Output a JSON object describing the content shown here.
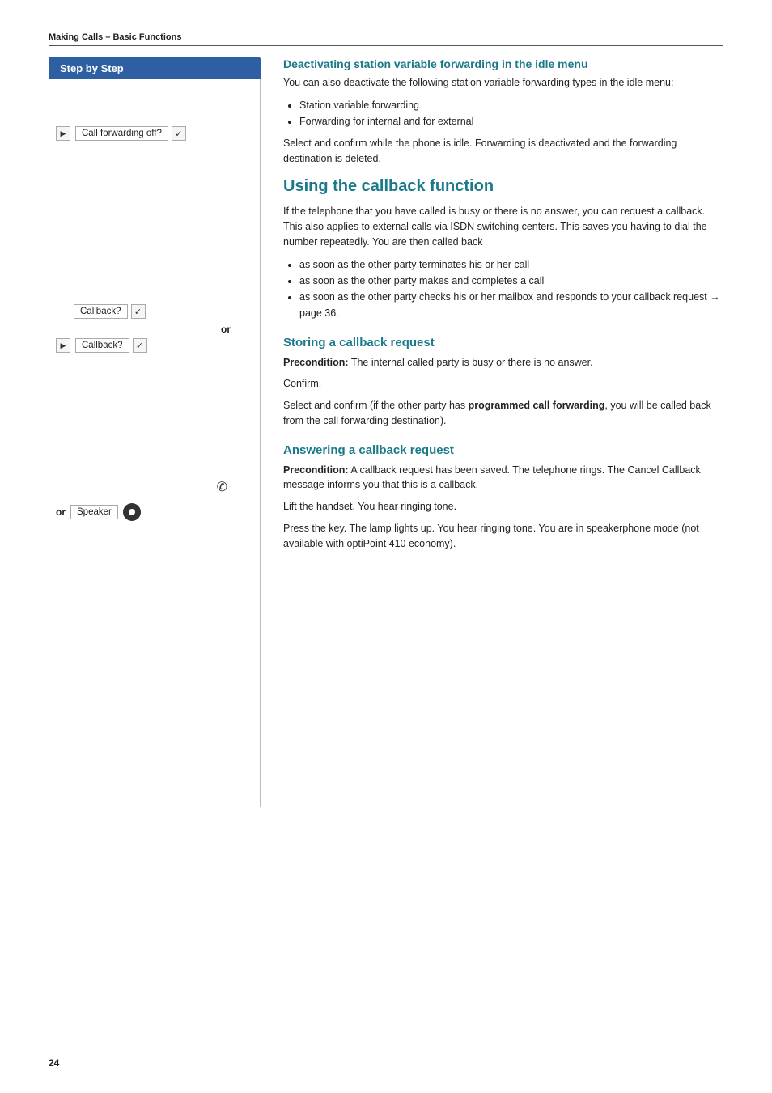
{
  "header": {
    "title": "Making Calls – Basic Functions"
  },
  "left_col": {
    "title": "Step by Step",
    "rows": [
      {
        "id": "call-forwarding-off",
        "has_play": true,
        "label": "Call forwarding off?",
        "has_check": true
      }
    ],
    "or_label": "or",
    "callback_rows": [
      {
        "id": "callback-1",
        "has_play": false,
        "label": "Callback?",
        "has_check": true
      },
      {
        "id": "callback-2",
        "has_play": true,
        "label": "Callback?",
        "has_check": true
      }
    ],
    "speaker_row": {
      "or_label": "or",
      "label": "Speaker"
    }
  },
  "right_col": {
    "deactivating_heading": "Deactivating station variable forwarding in the idle menu",
    "deactivating_intro": "You can also deactivate the following station variable forwarding types in the idle menu:",
    "deactivating_bullets": [
      "Station variable forwarding",
      "Forwarding for internal and for external"
    ],
    "deactivating_select_text": "Select and confirm while the phone is idle. Forwarding is deactivated and the forwarding destination is deleted.",
    "callback_section_title": "Using the callback function",
    "callback_intro": "If the telephone that you have called is busy or there is no answer, you can request a callback. This also applies to external calls via ISDN switching centers. This saves you having to dial the number repeatedly. You are then called back",
    "callback_bullets": [
      "as soon as the other party terminates his or her call",
      "as soon as the other party makes and completes a call",
      "as soon as the other party checks his or her mailbox and responds to your callback request → page 36."
    ],
    "storing_title": "Storing a callback request",
    "storing_precondition_label": "Precondition:",
    "storing_precondition_text": "The internal called party is busy or there is no answer.",
    "storing_confirm": "Confirm.",
    "storing_select": "Select and confirm (if the other party has ",
    "storing_select_bold": "programmed call forwarding",
    "storing_select_end": ", you will be called back from the call forwarding destination).",
    "answering_title": "Answering a callback request",
    "answering_precondition_label": "Precondition:",
    "answering_precondition_text": "A callback request has been saved. The telephone rings. The Cancel Callback message informs you that this is a callback.",
    "answering_lift": "Lift the handset. You hear ringing tone.",
    "answering_speaker": "Press the key. The lamp lights up. You hear ringing tone. You are in speakerphone mode (not available with optiPoint 410 economy)."
  },
  "page_number": "24"
}
